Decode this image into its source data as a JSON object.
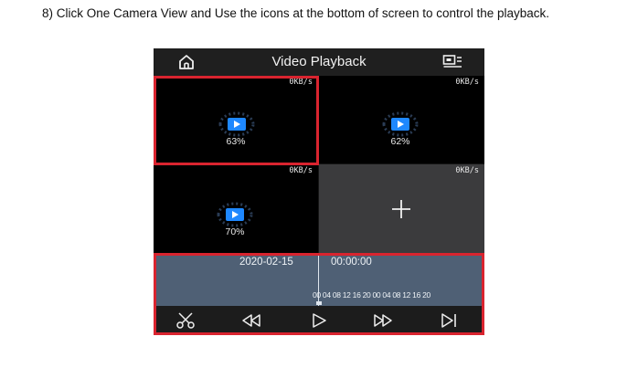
{
  "instruction": "8) Click One Camera View and Use the icons at the bottom of screen to control the playback.",
  "header": {
    "title": "Video Playback",
    "left_icon": "home-icon",
    "right_icon": "screen-layout-icon"
  },
  "cells": [
    {
      "speed": "0KB/s",
      "progress": "63%",
      "selected": true
    },
    {
      "speed": "0KB/s",
      "progress": "62%",
      "selected": false
    },
    {
      "speed": "0KB/s",
      "progress": "70%",
      "selected": false
    },
    {
      "speed": "0KB/s",
      "empty": true
    }
  ],
  "timeline": {
    "date": "2020-02-15",
    "time": "00:00:00",
    "ticks": "00 04 08 12 16 20 00 04 08 12 16 20"
  },
  "toolbar": {
    "icons": [
      "cut-icon",
      "rewind-icon",
      "play-icon",
      "fast-forward-icon",
      "next-frame-icon"
    ]
  },
  "colors": {
    "highlight": "#d9242f",
    "play_blue": "#1e88ff",
    "timeline_bg": "#4f6075"
  }
}
